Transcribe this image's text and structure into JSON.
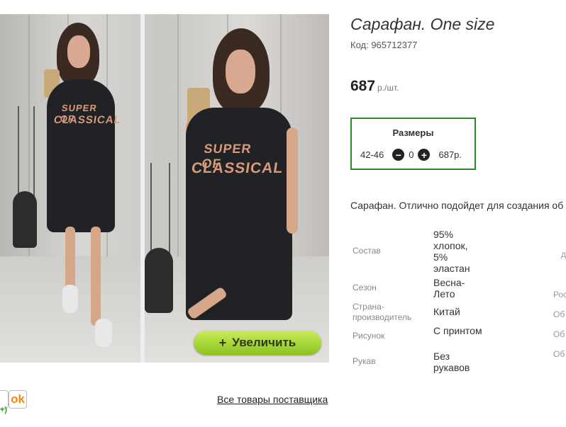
{
  "product": {
    "title": "Сарафан. One size",
    "code": "Код: 965712377",
    "price": "687",
    "price_unit": "р./шт."
  },
  "zoom_button": {
    "label": "Увеличить",
    "icon": "plus-icon"
  },
  "sizes": {
    "title": "Размеры",
    "row": {
      "size": "42-46",
      "quantity": "0",
      "price": "687р."
    }
  },
  "description": "Сарафан. Отлично подойдет для создания об",
  "properties": [
    {
      "name": "Состав",
      "value": "95% хлопок, 5% эластан"
    },
    {
      "name": "Сезон",
      "value": "Весна-Лето"
    },
    {
      "name": "Страна-производитель",
      "value": "Китай"
    },
    {
      "name": "Рисунок",
      "value": "С принтом"
    },
    {
      "name": "Рукав",
      "value": "Без рукавов"
    }
  ],
  "right_column": [
    "д",
    "Рос",
    "Об",
    "Об",
    "Об"
  ],
  "dress_print": [
    "SUPER OF",
    "CLASSICAL"
  ],
  "supplier_link": "Все товары поставщика",
  "share": {
    "ok_icon": "odnoklassniki-icon",
    "tiny": "+)"
  },
  "colors": {
    "accent_green": "#2b8a2b",
    "button_green": "#8cc21f"
  }
}
